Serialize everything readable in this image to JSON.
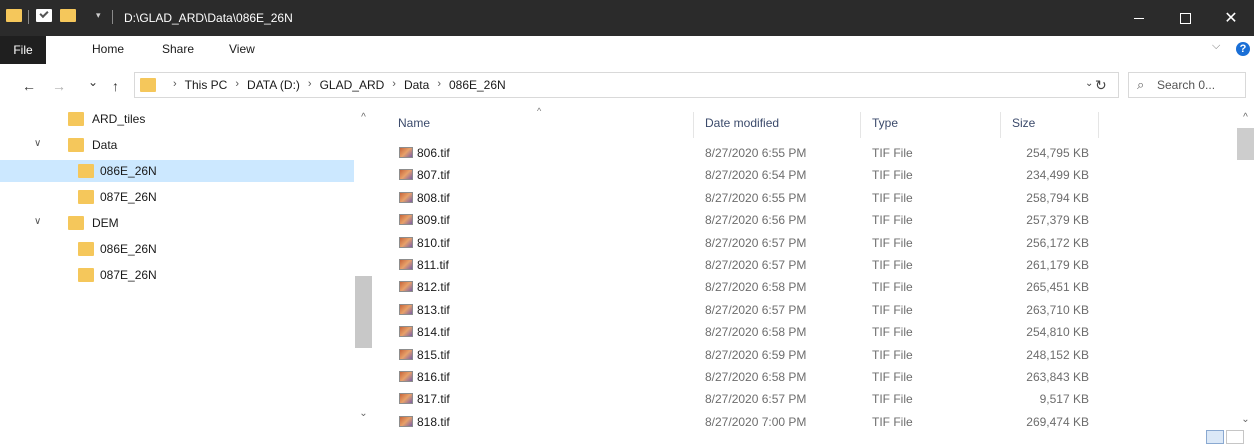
{
  "window": {
    "title": "D:\\GLAD_ARD\\Data\\086E_26N",
    "dropdown_glyph": "▾",
    "minimize_icon": "minimize-icon",
    "maximize_icon": "maximize-icon",
    "close_label": "✕"
  },
  "ribbon": {
    "tabs": [
      "File",
      "Home",
      "Share",
      "View"
    ],
    "expand_glyph": "⌵",
    "help_label": "?"
  },
  "nav": {
    "back": "←",
    "forward": "→",
    "recent": "⌄",
    "up": "↑",
    "breadcrumbs": [
      "This PC",
      "DATA (D:)",
      "GLAD_ARD",
      "Data",
      "086E_26N"
    ],
    "crumb_separator": "›",
    "address_dropdown": "⌄",
    "refresh": "↻"
  },
  "search": {
    "placeholder": "Search 0..."
  },
  "tree": [
    {
      "label": "ARD_tiles",
      "level": 1,
      "expanded": null,
      "selected": false
    },
    {
      "label": "Data",
      "level": 0,
      "expanded": true,
      "selected": false
    },
    {
      "label": "086E_26N",
      "level": 1,
      "expanded": null,
      "selected": true
    },
    {
      "label": "087E_26N",
      "level": 1,
      "expanded": null,
      "selected": false
    },
    {
      "label": "DEM",
      "level": 0,
      "expanded": true,
      "selected": false
    },
    {
      "label": "086E_26N",
      "level": 1,
      "expanded": null,
      "selected": false
    },
    {
      "label": "087E_26N",
      "level": 1,
      "expanded": null,
      "selected": false
    }
  ],
  "columns": {
    "name": "Name",
    "date": "Date modified",
    "type": "Type",
    "size": "Size",
    "sort_indicator": "^"
  },
  "files": [
    {
      "name": "806.tif",
      "date": "8/27/2020 6:55 PM",
      "type": "TIF File",
      "size": "254,795 KB"
    },
    {
      "name": "807.tif",
      "date": "8/27/2020 6:54 PM",
      "type": "TIF File",
      "size": "234,499 KB"
    },
    {
      "name": "808.tif",
      "date": "8/27/2020 6:55 PM",
      "type": "TIF File",
      "size": "258,794 KB"
    },
    {
      "name": "809.tif",
      "date": "8/27/2020 6:56 PM",
      "type": "TIF File",
      "size": "257,379 KB"
    },
    {
      "name": "810.tif",
      "date": "8/27/2020 6:57 PM",
      "type": "TIF File",
      "size": "256,172 KB"
    },
    {
      "name": "811.tif",
      "date": "8/27/2020 6:57 PM",
      "type": "TIF File",
      "size": "261,179 KB"
    },
    {
      "name": "812.tif",
      "date": "8/27/2020 6:58 PM",
      "type": "TIF File",
      "size": "265,451 KB"
    },
    {
      "name": "813.tif",
      "date": "8/27/2020 6:57 PM",
      "type": "TIF File",
      "size": "263,710 KB"
    },
    {
      "name": "814.tif",
      "date": "8/27/2020 6:58 PM",
      "type": "TIF File",
      "size": "254,810 KB"
    },
    {
      "name": "815.tif",
      "date": "8/27/2020 6:59 PM",
      "type": "TIF File",
      "size": "248,152 KB"
    },
    {
      "name": "816.tif",
      "date": "8/27/2020 6:58 PM",
      "type": "TIF File",
      "size": "263,843 KB"
    },
    {
      "name": "817.tif",
      "date": "8/27/2020 6:57 PM",
      "type": "TIF File",
      "size": "9,517 KB"
    },
    {
      "name": "818.tif",
      "date": "8/27/2020 7:00 PM",
      "type": "TIF File",
      "size": "269,474 KB"
    }
  ],
  "scroll": {
    "up": "^",
    "down": "⌄"
  },
  "colors": {
    "titlebar": "#2b2b2b",
    "folder": "#f5c75b",
    "selection": "#cce8ff"
  }
}
